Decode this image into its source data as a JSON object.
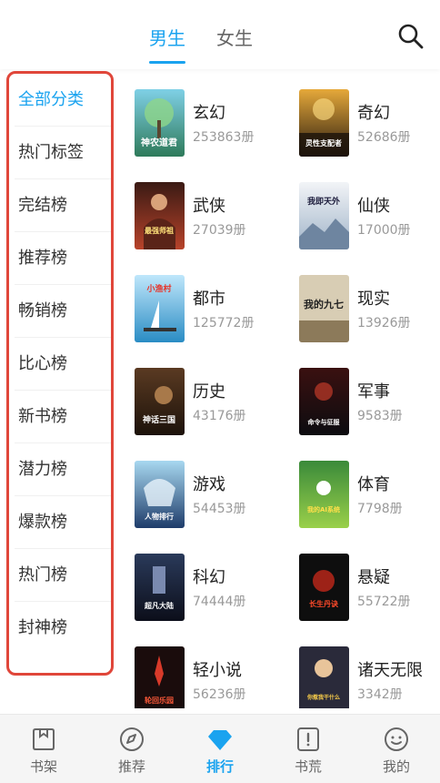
{
  "header": {
    "tabs": [
      {
        "label": "男生",
        "active": true
      },
      {
        "label": "女生",
        "active": false
      }
    ],
    "search_icon": "search-icon"
  },
  "sidebar": {
    "items": [
      {
        "label": "全部分类",
        "active": true
      },
      {
        "label": "热门标签"
      },
      {
        "label": "完结榜"
      },
      {
        "label": "推荐榜"
      },
      {
        "label": "畅销榜"
      },
      {
        "label": "比心榜"
      },
      {
        "label": "新书榜"
      },
      {
        "label": "潜力榜"
      },
      {
        "label": "爆款榜"
      },
      {
        "label": "热门榜"
      },
      {
        "label": "封神榜"
      }
    ]
  },
  "categories": [
    {
      "name": "玄幻",
      "count": "253863册",
      "cover_text": "神农道君"
    },
    {
      "name": "奇幻",
      "count": "52686册",
      "cover_text": "灵性支配者"
    },
    {
      "name": "武侠",
      "count": "27039册",
      "cover_text": "最强师祖"
    },
    {
      "name": "仙侠",
      "count": "17000册",
      "cover_text": "我即天外"
    },
    {
      "name": "都市",
      "count": "125772册",
      "cover_text": "小渔村"
    },
    {
      "name": "现实",
      "count": "13926册",
      "cover_text": "我的九七"
    },
    {
      "name": "历史",
      "count": "43176册",
      "cover_text": "神话三国"
    },
    {
      "name": "军事",
      "count": "9583册",
      "cover_text": "命令与征服"
    },
    {
      "name": "游戏",
      "count": "54453册",
      "cover_text": "人物排行"
    },
    {
      "name": "体育",
      "count": "7798册",
      "cover_text": "我的AI系统"
    },
    {
      "name": "科幻",
      "count": "74444册",
      "cover_text": "超凡大陆"
    },
    {
      "name": "悬疑",
      "count": "55722册",
      "cover_text": "长生丹诀"
    },
    {
      "name": "轻小说",
      "count": "56236册",
      "cover_text": "轮回乐园"
    },
    {
      "name": "诸天无限",
      "count": "3342册",
      "cover_text": "你惹我干什么"
    }
  ],
  "bottom_nav": [
    {
      "label": "书架",
      "icon": "bookshelf-icon"
    },
    {
      "label": "推荐",
      "icon": "compass-icon"
    },
    {
      "label": "排行",
      "icon": "diamond-icon",
      "active": true
    },
    {
      "label": "书荒",
      "icon": "book-alert-icon"
    },
    {
      "label": "我的",
      "icon": "smiley-face-icon"
    }
  ],
  "colors": {
    "accent": "#1aa3ef",
    "sidebar_border": "#e0463a"
  }
}
